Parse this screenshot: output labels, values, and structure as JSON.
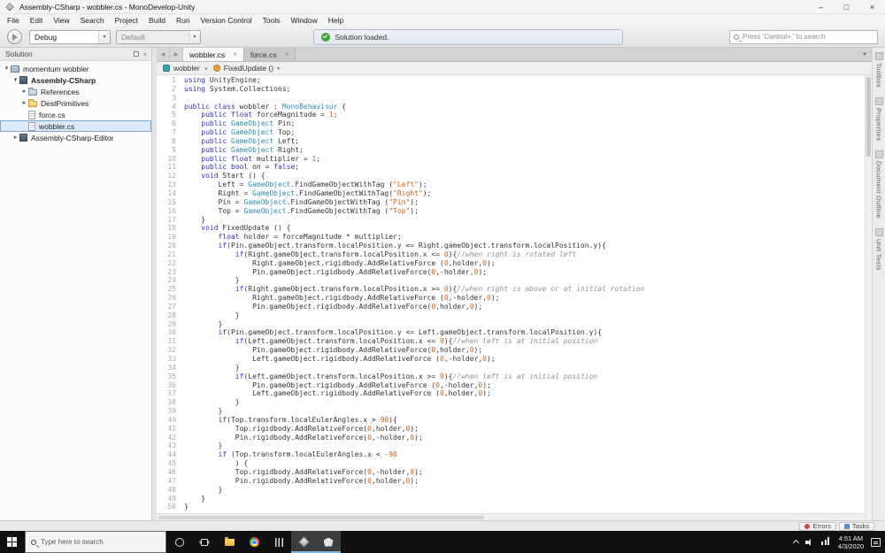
{
  "window": {
    "title": "Assembly-CSharp - wobbler.cs - MonoDevelop-Unity",
    "menus": [
      "File",
      "Edit",
      "View",
      "Search",
      "Project",
      "Build",
      "Run",
      "Version Control",
      "Tools",
      "Window",
      "Help"
    ]
  },
  "toolbar": {
    "config_value": "Debug",
    "platform_value": "Default",
    "status_text": "Solution loaded.",
    "search_placeholder": "Press 'Control+,' to search"
  },
  "solution_pad": {
    "title": "Solution",
    "items": [
      {
        "label": "momentum wobbler",
        "icon": "solution",
        "depth": 0,
        "expander": "down",
        "bold": false
      },
      {
        "label": "Assembly-CSharp",
        "icon": "project",
        "depth": 1,
        "expander": "down",
        "bold": true
      },
      {
        "label": "References",
        "icon": "references",
        "depth": 2,
        "expander": "right"
      },
      {
        "label": "DestPrimitives",
        "icon": "folder",
        "depth": 2,
        "expander": "right"
      },
      {
        "label": "force.cs",
        "icon": "file",
        "depth": 2
      },
      {
        "label": "wobbler.cs",
        "icon": "file",
        "depth": 2,
        "selected": true
      },
      {
        "label": "Assembly-CSharp-Editor",
        "icon": "project",
        "depth": 1,
        "expander": "right"
      }
    ]
  },
  "editor": {
    "tabs": [
      {
        "label": "wobbler.cs",
        "active": true
      },
      {
        "label": "force.cs",
        "active": false
      }
    ],
    "breadcrumb": {
      "class_name": "wobbler",
      "member": "FixedUpdate ()"
    },
    "code": [
      [
        [
          "k",
          "using"
        ],
        [
          "p",
          " UnityEngine;"
        ]
      ],
      [
        [
          "k",
          "using"
        ],
        [
          "p",
          " System.Collections;"
        ]
      ],
      [
        [
          "p",
          ""
        ]
      ],
      [
        [
          "k",
          "public"
        ],
        [
          "p",
          " "
        ],
        [
          "k",
          "class"
        ],
        [
          "p",
          " wobbler : "
        ],
        [
          "t",
          "MonoBehaviour"
        ],
        [
          "p",
          " {"
        ]
      ],
      [
        [
          "p",
          "    "
        ],
        [
          "k",
          "public"
        ],
        [
          "p",
          " "
        ],
        [
          "k",
          "float"
        ],
        [
          "p",
          " forceMagnitude = "
        ],
        [
          "n",
          "1"
        ],
        [
          "p",
          ";"
        ]
      ],
      [
        [
          "p",
          "    "
        ],
        [
          "k",
          "public"
        ],
        [
          "p",
          " "
        ],
        [
          "t",
          "GameObject"
        ],
        [
          "p",
          " Pin;"
        ]
      ],
      [
        [
          "p",
          "    "
        ],
        [
          "k",
          "public"
        ],
        [
          "p",
          " "
        ],
        [
          "t",
          "GameObject"
        ],
        [
          "p",
          " Top;"
        ]
      ],
      [
        [
          "p",
          "    "
        ],
        [
          "k",
          "public"
        ],
        [
          "p",
          " "
        ],
        [
          "t",
          "GameObject"
        ],
        [
          "p",
          " Left;"
        ]
      ],
      [
        [
          "p",
          "    "
        ],
        [
          "k",
          "public"
        ],
        [
          "p",
          " "
        ],
        [
          "t",
          "GameObject"
        ],
        [
          "p",
          " Right;"
        ]
      ],
      [
        [
          "p",
          "    "
        ],
        [
          "k",
          "public"
        ],
        [
          "p",
          " "
        ],
        [
          "k",
          "float"
        ],
        [
          "p",
          " multiplier = "
        ],
        [
          "n",
          "1"
        ],
        [
          "p",
          ";"
        ]
      ],
      [
        [
          "p",
          "    "
        ],
        [
          "k",
          "public"
        ],
        [
          "p",
          " "
        ],
        [
          "k",
          "bool"
        ],
        [
          "p",
          " on = "
        ],
        [
          "k",
          "false"
        ],
        [
          "p",
          ";"
        ]
      ],
      [
        [
          "p",
          "    "
        ],
        [
          "k",
          "void"
        ],
        [
          "p",
          " Start () {"
        ]
      ],
      [
        [
          "p",
          "        Left = "
        ],
        [
          "t",
          "GameObject"
        ],
        [
          "p",
          ".FindGameObjectWithTag ("
        ],
        [
          "s",
          "\"Left\""
        ],
        [
          "p",
          ");"
        ]
      ],
      [
        [
          "p",
          "        Right = "
        ],
        [
          "t",
          "GameObject"
        ],
        [
          "p",
          ".FindGameObjectWithTag("
        ],
        [
          "s",
          "\"Right\""
        ],
        [
          "p",
          ");"
        ]
      ],
      [
        [
          "p",
          "        Pin = "
        ],
        [
          "t",
          "GameObject"
        ],
        [
          "p",
          ".FindGameObjectWithTag ("
        ],
        [
          "s",
          "\"Pin\""
        ],
        [
          "p",
          ");"
        ]
      ],
      [
        [
          "p",
          "        Top = "
        ],
        [
          "t",
          "GameObject"
        ],
        [
          "p",
          ".FindGameObjectWithTag ("
        ],
        [
          "s",
          "\"Top\""
        ],
        [
          "p",
          ");"
        ]
      ],
      [
        [
          "p",
          "    }"
        ]
      ],
      [
        [
          "p",
          "    "
        ],
        [
          "k",
          "void"
        ],
        [
          "p",
          " FixedUpdate () {"
        ]
      ],
      [
        [
          "p",
          "        "
        ],
        [
          "k",
          "float"
        ],
        [
          "p",
          " holder = forceMagnitude * multiplier;"
        ]
      ],
      [
        [
          "p",
          "        "
        ],
        [
          "k",
          "if"
        ],
        [
          "p",
          "(Pin.gameObject.transform.localPosition.y <= Right.gameObject.transform.localPosition.y){"
        ]
      ],
      [
        [
          "p",
          "            "
        ],
        [
          "k",
          "if"
        ],
        [
          "p",
          "(Right.gameObject.transform.localPosition.x <= "
        ],
        [
          "n",
          "0"
        ],
        [
          "p",
          "){"
        ],
        [
          "c",
          "//when right is rotated left"
        ]
      ],
      [
        [
          "p",
          "                Right.gameObject.rigidbody.AddRelativeForce ("
        ],
        [
          "n",
          "0"
        ],
        [
          "p",
          ",holder,"
        ],
        [
          "n",
          "0"
        ],
        [
          "p",
          ");"
        ]
      ],
      [
        [
          "p",
          "                Pin.gameObject.rigidbody.AddRelativeForce("
        ],
        [
          "n",
          "0"
        ],
        [
          "p",
          ",-holder,"
        ],
        [
          "n",
          "0"
        ],
        [
          "p",
          ");"
        ]
      ],
      [
        [
          "p",
          "            }"
        ]
      ],
      [
        [
          "p",
          "            "
        ],
        [
          "k",
          "if"
        ],
        [
          "p",
          "(Right.gameObject.transform.localPosition.x >= "
        ],
        [
          "n",
          "0"
        ],
        [
          "p",
          "){"
        ],
        [
          "c",
          "//when right is above or at initial rotation"
        ]
      ],
      [
        [
          "p",
          "                Right.gameObject.rigidbody.AddRelativeForce ("
        ],
        [
          "n",
          "0"
        ],
        [
          "p",
          ",-holder,"
        ],
        [
          "n",
          "0"
        ],
        [
          "p",
          ");"
        ]
      ],
      [
        [
          "p",
          "                Pin.gameObject.rigidbody.AddRelativeForce("
        ],
        [
          "n",
          "0"
        ],
        [
          "p",
          ",holder,"
        ],
        [
          "n",
          "0"
        ],
        [
          "p",
          ");"
        ]
      ],
      [
        [
          "p",
          "            }"
        ]
      ],
      [
        [
          "p",
          "        }"
        ]
      ],
      [
        [
          "p",
          "        "
        ],
        [
          "k",
          "if"
        ],
        [
          "p",
          "(Pin.gameObject.transform.localPosition.y <= Left.gameObject.transform.localPosition.y){"
        ]
      ],
      [
        [
          "p",
          "            "
        ],
        [
          "k",
          "if"
        ],
        [
          "p",
          "(Left.gameObject.transform.localPosition.x <= "
        ],
        [
          "n",
          "0"
        ],
        [
          "p",
          "){"
        ],
        [
          "c",
          "//when left is at initial position"
        ]
      ],
      [
        [
          "p",
          "                Pin.gameObject.rigidbody.AddRelativeForce("
        ],
        [
          "n",
          "0"
        ],
        [
          "p",
          ",holder,"
        ],
        [
          "n",
          "0"
        ],
        [
          "p",
          ");"
        ]
      ],
      [
        [
          "p",
          "                Left.gameObject.rigidbody.AddRelativeForce ("
        ],
        [
          "n",
          "0"
        ],
        [
          "p",
          ",-holder,"
        ],
        [
          "n",
          "0"
        ],
        [
          "p",
          ");"
        ]
      ],
      [
        [
          "p",
          "            }"
        ]
      ],
      [
        [
          "p",
          "            "
        ],
        [
          "k",
          "if"
        ],
        [
          "p",
          "(Left.gameObject.transform.localPosition.x >= "
        ],
        [
          "n",
          "0"
        ],
        [
          "p",
          "){"
        ],
        [
          "c",
          "//when left is at initial position"
        ]
      ],
      [
        [
          "p",
          "                Pin.gameObject.rigidbody.AddRelativeForce ("
        ],
        [
          "n",
          "0"
        ],
        [
          "p",
          ",-holder,"
        ],
        [
          "n",
          "0"
        ],
        [
          "p",
          ");"
        ]
      ],
      [
        [
          "p",
          "                Left.gameObject.rigidbody.AddRelativeForce ("
        ],
        [
          "n",
          "0"
        ],
        [
          "p",
          ",holder,"
        ],
        [
          "n",
          "0"
        ],
        [
          "p",
          ");"
        ]
      ],
      [
        [
          "p",
          "            }"
        ]
      ],
      [
        [
          "p",
          "        }"
        ]
      ],
      [
        [
          "p",
          "        "
        ],
        [
          "k",
          "if"
        ],
        [
          "p",
          "(Top.transform.localEulerAngles.x > "
        ],
        [
          "n",
          "90"
        ],
        [
          "p",
          "){"
        ]
      ],
      [
        [
          "p",
          "            Top.rigidbody.AddRelativeForce("
        ],
        [
          "n",
          "0"
        ],
        [
          "p",
          ",holder,"
        ],
        [
          "n",
          "0"
        ],
        [
          "p",
          ");"
        ]
      ],
      [
        [
          "p",
          "            Pin.rigidbody.AddRelativeForce("
        ],
        [
          "n",
          "0"
        ],
        [
          "p",
          ",-holder,"
        ],
        [
          "n",
          "0"
        ],
        [
          "p",
          ");"
        ]
      ],
      [
        [
          "p",
          "        }"
        ]
      ],
      [
        [
          "p",
          "        "
        ],
        [
          "k",
          "if"
        ],
        [
          "p",
          " (Top.transform.localEulerAngles.x < "
        ],
        [
          "n",
          "-90"
        ]
      ],
      [
        [
          "p",
          "            ) {"
        ]
      ],
      [
        [
          "p",
          "            Top.rigidbody.AddRelativeForce("
        ],
        [
          "n",
          "0"
        ],
        [
          "p",
          ",-holder,"
        ],
        [
          "n",
          "0"
        ],
        [
          "p",
          ");"
        ]
      ],
      [
        [
          "p",
          "            Pin.rigidbody.AddRelativeForce("
        ],
        [
          "n",
          "0"
        ],
        [
          "p",
          ",holder,"
        ],
        [
          "n",
          "0"
        ],
        [
          "p",
          ");"
        ]
      ],
      [
        [
          "p",
          "        }"
        ]
      ],
      [
        [
          "p",
          "    }"
        ]
      ],
      [
        [
          "p",
          "}"
        ]
      ]
    ]
  },
  "right_dock": {
    "tabs": [
      "Toolbox",
      "Properties",
      "Document Outline",
      "Unit Tests"
    ]
  },
  "bottom_dock": {
    "tabs": [
      "Errors",
      "Tasks"
    ]
  },
  "taskbar": {
    "search_placeholder": "Type here to search",
    "buttons": [
      {
        "name": "cortana"
      },
      {
        "name": "task-view"
      },
      {
        "name": "file-explorer"
      },
      {
        "name": "chrome"
      },
      {
        "name": "audio-mixer"
      },
      {
        "name": "monodevelop",
        "active": true
      },
      {
        "name": "unity",
        "active": true
      }
    ],
    "tray": {
      "time": "4:51 AM",
      "date": "4/3/2020"
    }
  }
}
